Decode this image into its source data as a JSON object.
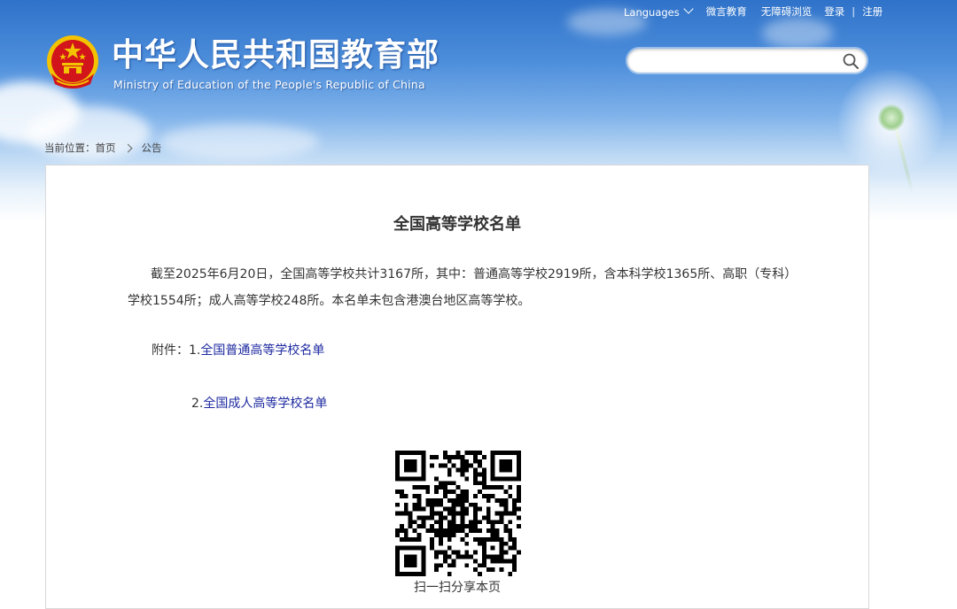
{
  "header": {
    "top_links": {
      "languages": "Languages",
      "weibo": "微言教育",
      "accessibility": "无障碍浏览",
      "login": "登录",
      "separator": "|",
      "register": "注册"
    },
    "logo_cn": "中华人民共和国教育部",
    "logo_en": "Ministry of Education of the People's Republic of China",
    "search": {
      "value": "",
      "placeholder": ""
    }
  },
  "breadcrumb": {
    "label": "当前位置：",
    "home": "首页",
    "current": "公告"
  },
  "article": {
    "title": "全国高等学校名单",
    "paragraph": "截至2025年6月20日，全国高等学校共计3167所，其中：普通高等学校2919所，含本科学校1365所、高职（专科）学校1554所；成人高等学校248所。本名单未包含港澳台地区高等学校。",
    "attachment_label": "附件：",
    "attachments": [
      {
        "number": "1.",
        "text": "全国普通高等学校名单"
      },
      {
        "number": "2.",
        "text": "全国成人高等学校名单"
      }
    ],
    "qr_caption": "扫一扫分享本页"
  },
  "colors": {
    "header_blue": "#2f72c9",
    "link_blue": "#1e2aa0",
    "emblem_red": "#d2141b",
    "emblem_gold": "#f3c300"
  },
  "icons": {
    "search": "search-icon",
    "emblem": "national-emblem-icon",
    "languages_chevron": "chevron-down-icon",
    "breadcrumb_chevron": "chevron-right-icon",
    "qr": "qr-code"
  }
}
